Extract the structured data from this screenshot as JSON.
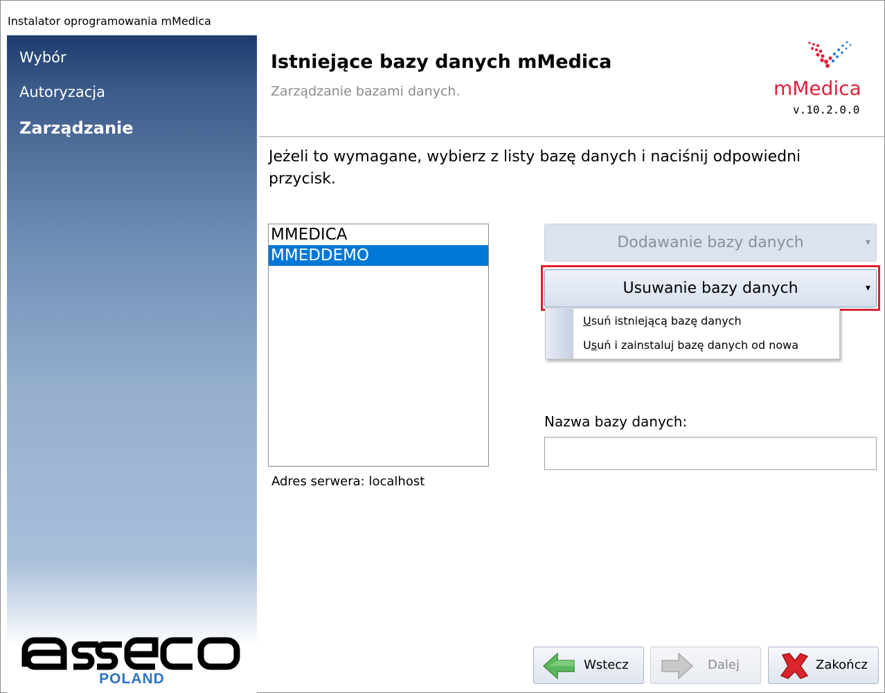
{
  "window": {
    "title": "Instalator oprogramowania mMedica"
  },
  "sidebar": {
    "items": [
      {
        "label": "Wybór",
        "active": false
      },
      {
        "label": "Autoryzacja",
        "active": false
      },
      {
        "label": "Zarządzanie",
        "active": true
      }
    ],
    "brand_subtitle": "POLAND"
  },
  "header": {
    "title": "Istniejące bazy danych mMedica",
    "subtitle": "Zarządzanie bazami danych.",
    "brand_name": "mMedica",
    "version": "v.10.2.0.0"
  },
  "main": {
    "instruction": "Jeżeli to wymagane, wybierz z listy bazę danych i naciśnij odpowiedni przycisk.",
    "databases": [
      {
        "name": "MMEDICA",
        "selected": false
      },
      {
        "name": "MMEDDEMO",
        "selected": true
      }
    ],
    "server_address": "Adres serwera: localhost",
    "add_button": "Dodawanie bazy danych",
    "remove_button": "Usuwanie bazy danych",
    "remove_menu": {
      "item1_key": "U",
      "item1_rest": "suń istniejącą bazę danych",
      "item2_pre": "U",
      "item2_key": "s",
      "item2_rest": "uń i zainstaluj bazę danych od nowa"
    },
    "name_label": "Nazwa bazy danych:",
    "name_value": ""
  },
  "footer": {
    "back": "Wstecz",
    "next": "Dalej",
    "finish": "Zakończ"
  },
  "colors": {
    "selection": "#0078d7",
    "highlight": "#e0202e",
    "brand_red": "#e0203a",
    "asseco_blue": "#2b73c5"
  }
}
